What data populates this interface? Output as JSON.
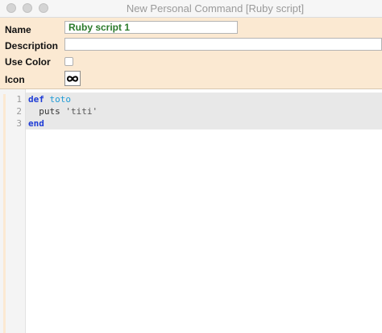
{
  "window": {
    "title": "New Personal Command [Ruby script]"
  },
  "form": {
    "name_label": "Name",
    "name_value": "Ruby script 1",
    "description_label": "Description",
    "description_value": "",
    "use_color_label": "Use Color",
    "use_color_checked": false,
    "icon_label": "Icon",
    "icon": "infinity-icon"
  },
  "editor": {
    "line_numbers": [
      "1",
      "2",
      "3"
    ],
    "lines": [
      {
        "keyword": "def",
        "name": "toto"
      },
      {
        "indent": "  ",
        "call": "puts",
        "string": "'titi'"
      },
      {
        "keyword": "end"
      }
    ]
  },
  "colors": {
    "form_background": "#fbe9d2",
    "name_text": "#2b7a2b",
    "keyword": "#1d3bd6",
    "method_name": "#1f9bd6"
  }
}
